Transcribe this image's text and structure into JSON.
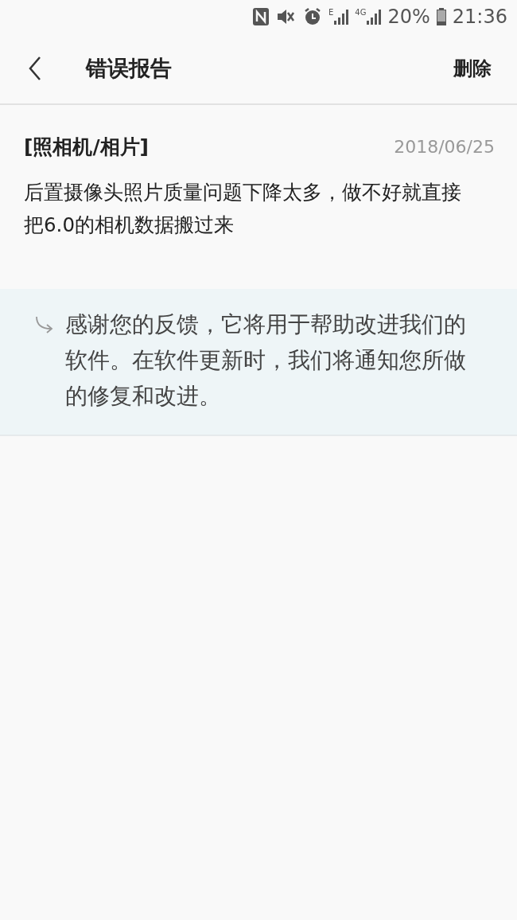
{
  "status_bar": {
    "signal_1_type": "E",
    "signal_2_type": "4G",
    "battery": "20%",
    "time": "21:36"
  },
  "header": {
    "title": "错误报告",
    "action": "删除"
  },
  "report": {
    "category": "[照相机/相片]",
    "date": "2018/06/25",
    "body": "后置摄像头照片质量问题下降太多，做不好就直接把6.0的相机数据搬过来"
  },
  "reply": {
    "text": "感谢您的反馈，它将用于帮助改进我们的软件。在软件更新时，我们将通知您所做的修复和改进。"
  }
}
